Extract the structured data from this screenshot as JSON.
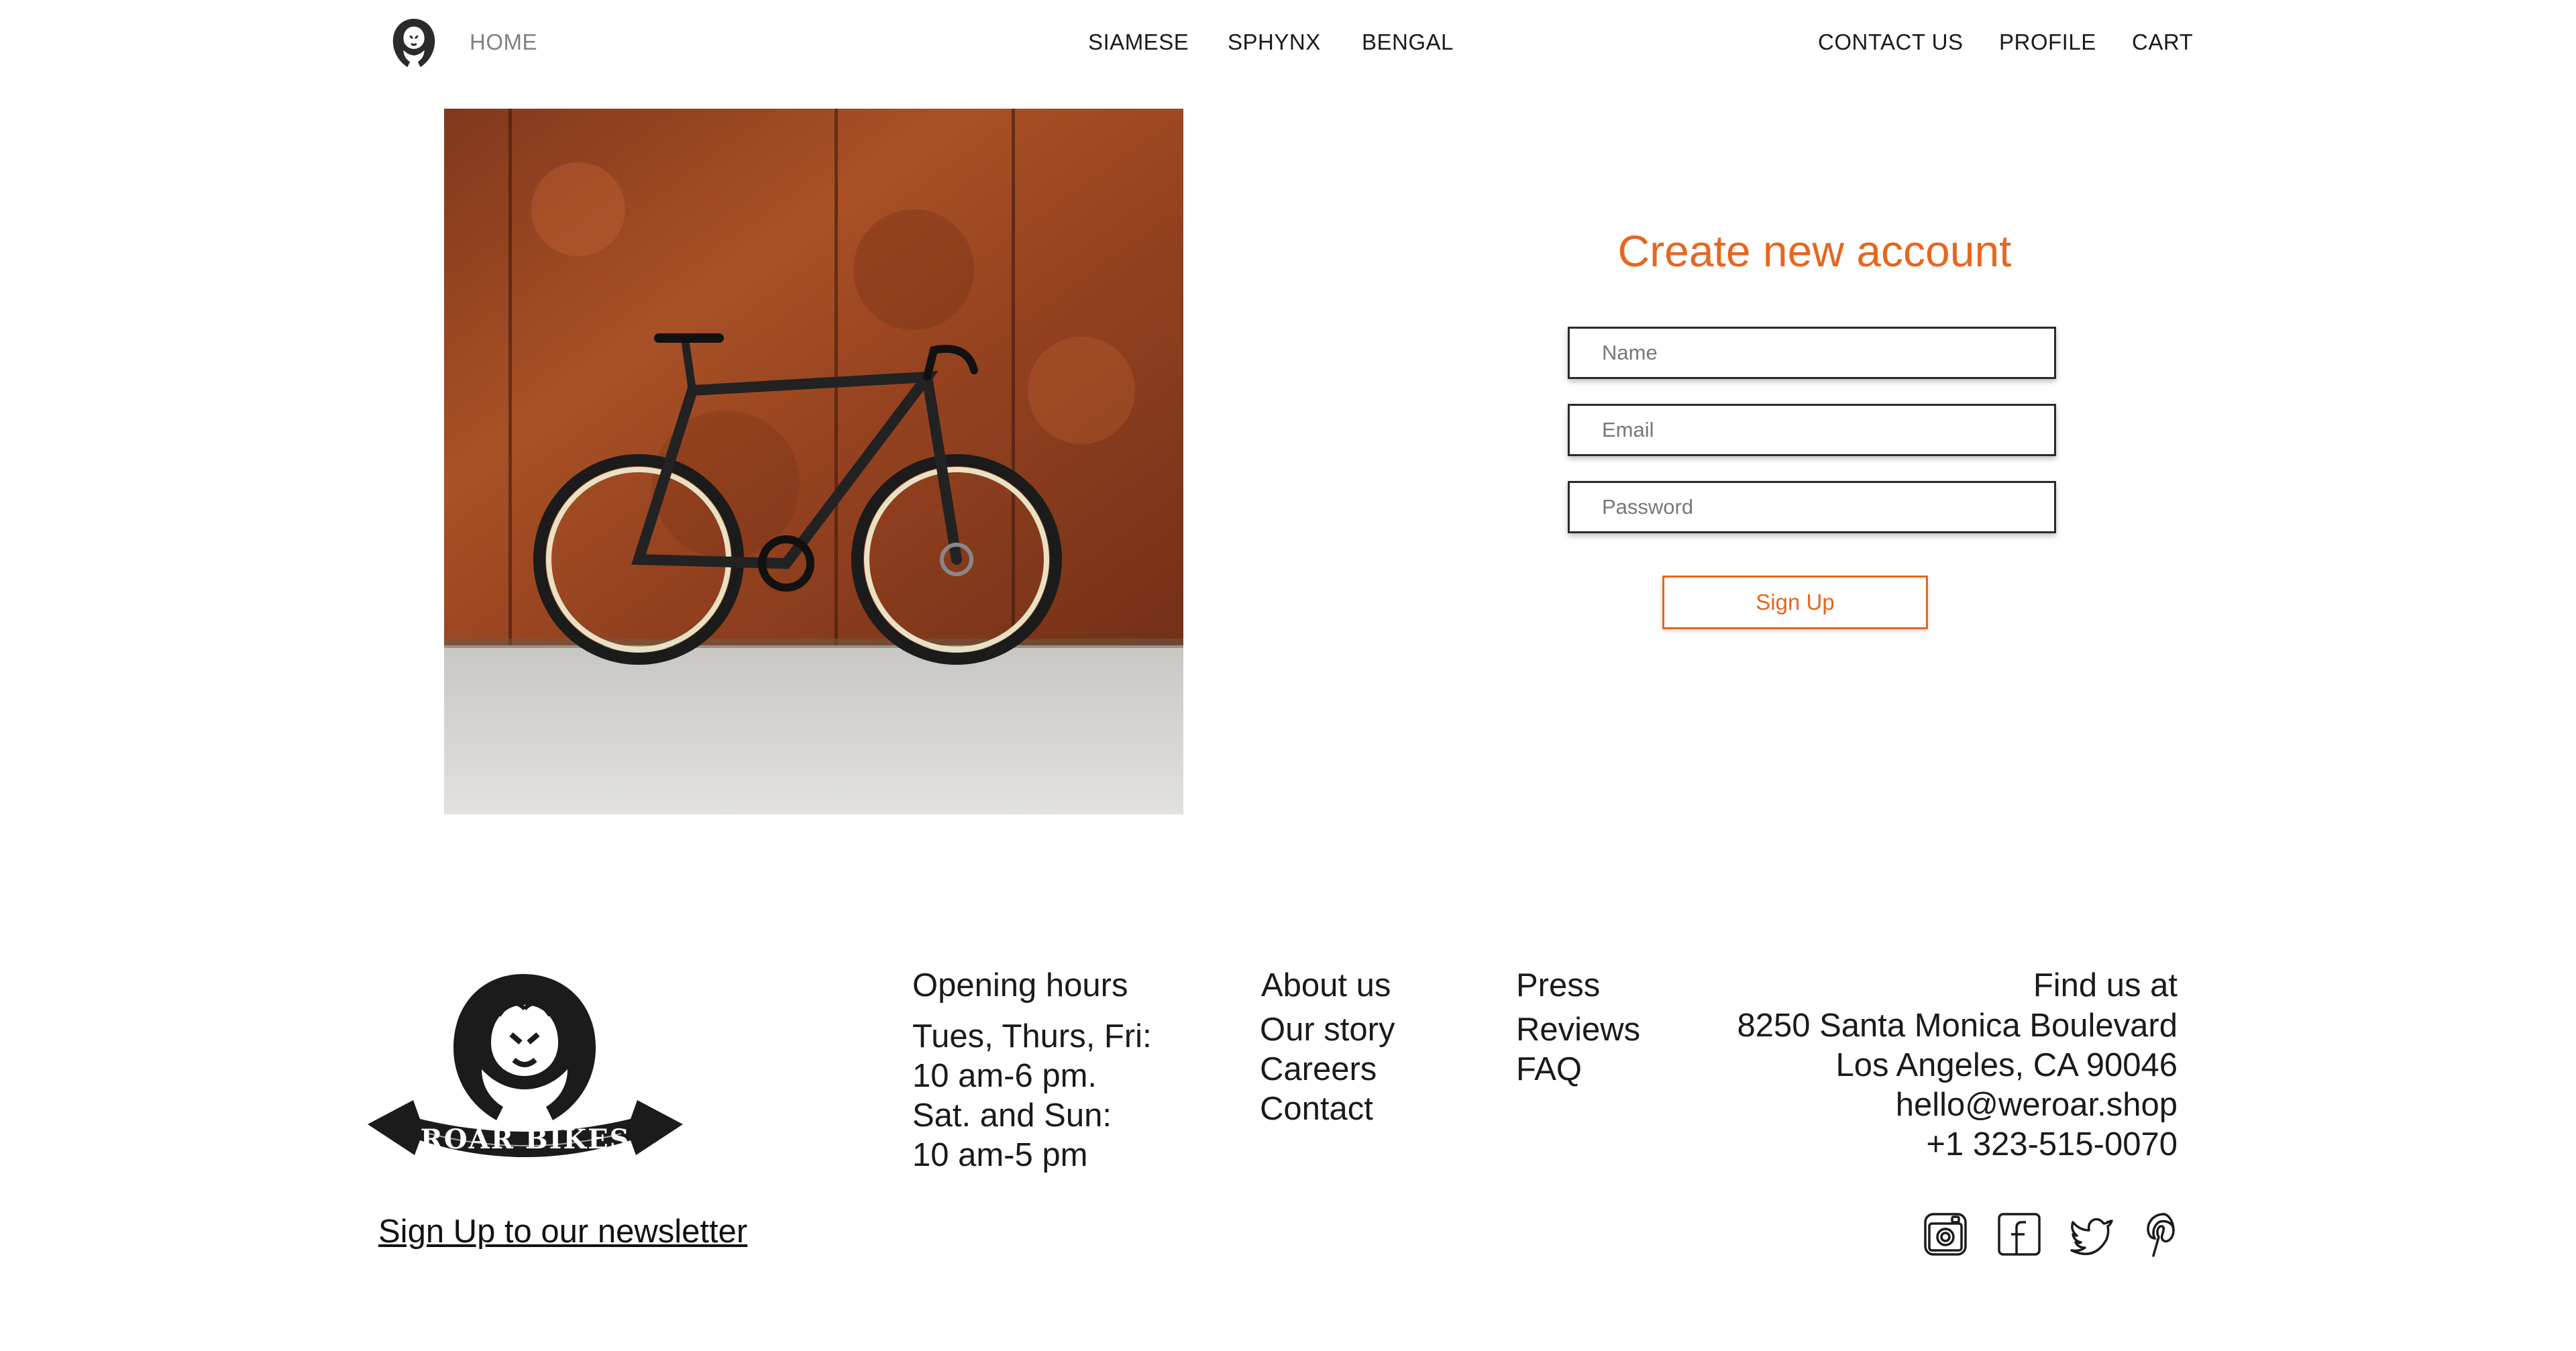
{
  "header": {
    "home": "HOME",
    "nav_center": [
      "SIAMESE",
      "SPHYNX",
      "BENGAL"
    ],
    "nav_right": [
      "CONTACT US",
      "PROFILE",
      "CART"
    ]
  },
  "form": {
    "title": "Create new account",
    "name_placeholder": "Name",
    "email_placeholder": "Email",
    "password_placeholder": "Password",
    "submit_label": "Sign Up"
  },
  "footer": {
    "brand_banner": "ROAR BIKES",
    "opening_hours": {
      "heading": "Opening hours",
      "lines": [
        "Tues, Thurs, Fri:",
        "10 am-6 pm.",
        "Sat. and Sun:",
        "10 am-5 pm"
      ]
    },
    "links_col1": [
      "About us",
      "Our story",
      "Careers",
      "Contact"
    ],
    "links_col2": [
      "Press",
      "Reviews",
      "FAQ"
    ],
    "find_us": {
      "heading": "Find us at",
      "lines": [
        "8250 Santa Monica Boulevard",
        "Los Angeles, CA 90046",
        "hello@weroar.shop",
        "+1 323-515-0070"
      ]
    },
    "newsletter": "Sign Up to our newsletter",
    "social_icons": [
      "instagram-icon",
      "facebook-icon",
      "twitter-icon",
      "pinterest-icon"
    ]
  },
  "colors": {
    "accent": "#e8661d",
    "text": "#111111",
    "muted": "#808080"
  }
}
